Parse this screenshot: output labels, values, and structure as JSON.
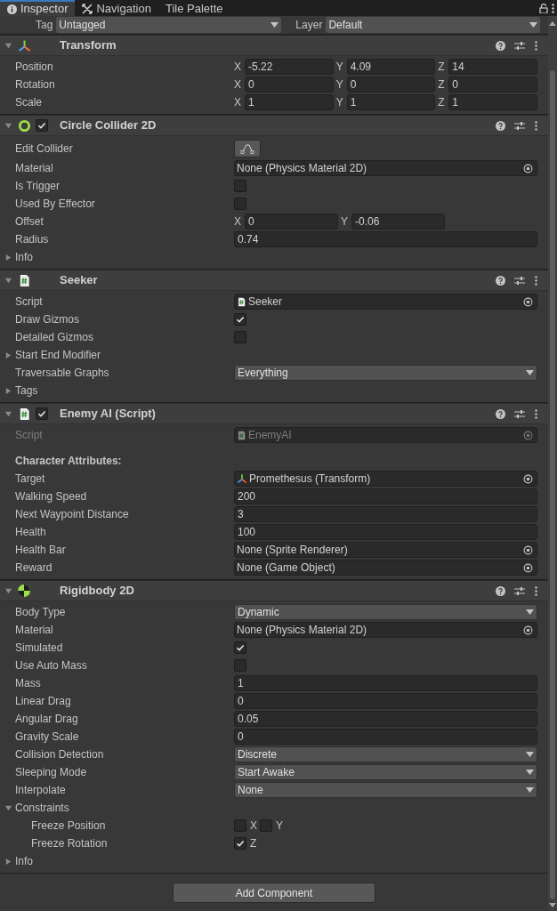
{
  "tabs": [
    {
      "label": "Inspector",
      "kind": "info",
      "selected": true
    },
    {
      "label": "Navigation",
      "kind": "nav",
      "selected": false
    },
    {
      "label": "Tile Palette",
      "kind": "none",
      "selected": false
    }
  ],
  "tag_row": {
    "tag_label": "Tag",
    "tag_value": "Untagged",
    "layer_label": "Layer",
    "layer_value": "Default"
  },
  "components": [
    {
      "title": "Transform",
      "kind": "transform",
      "rows": [
        {
          "kind": "vector",
          "label": "Position",
          "fields": [
            {
              "axis": "X",
              "value": "-5.22"
            },
            {
              "axis": "Y",
              "value": "4.09"
            },
            {
              "axis": "Z",
              "value": "14"
            }
          ]
        },
        {
          "kind": "vector",
          "label": "Rotation",
          "fields": [
            {
              "axis": "X",
              "value": "0"
            },
            {
              "axis": "Y",
              "value": "0"
            },
            {
              "axis": "Z",
              "value": "0"
            }
          ]
        },
        {
          "kind": "vector",
          "label": "Scale",
          "fields": [
            {
              "axis": "X",
              "value": "1"
            },
            {
              "axis": "Y",
              "value": "1"
            },
            {
              "axis": "Z",
              "value": "1"
            }
          ]
        }
      ]
    },
    {
      "title": "Circle Collider 2D",
      "kind": "collider",
      "enabled": true,
      "rows": [
        {
          "kind": "edit",
          "label": "Edit Collider"
        },
        {
          "kind": "object",
          "label": "Material",
          "value": "None (Physics Material 2D)",
          "disabled": false
        },
        {
          "kind": "checkbox",
          "label": "Is Trigger",
          "checked": false
        },
        {
          "kind": "checkbox",
          "label": "Used By Effector",
          "checked": false
        },
        {
          "kind": "vector",
          "label": "Offset",
          "fields": [
            {
              "axis": "X",
              "value": "0"
            },
            {
              "axis": "Y",
              "value": "-0.06"
            }
          ]
        },
        {
          "kind": "text",
          "label": "Radius",
          "value": "0.74"
        },
        {
          "kind": "foldout",
          "label": "Info",
          "expanded": false
        }
      ]
    },
    {
      "title": "Seeker",
      "kind": "script",
      "rows": [
        {
          "kind": "scriptref",
          "label": "Script",
          "value": "Seeker",
          "disabled": false
        },
        {
          "kind": "checkbox",
          "label": "Draw Gizmos",
          "checked": true
        },
        {
          "kind": "checkbox",
          "label": "Detailed Gizmos",
          "checked": false
        },
        {
          "kind": "foldout",
          "label": "Start End Modifier",
          "expanded": false
        },
        {
          "kind": "dropdown",
          "label": "Traversable Graphs",
          "value": "Everything"
        },
        {
          "kind": "foldout",
          "label": "Tags",
          "expanded": false
        }
      ]
    },
    {
      "title": "Enemy AI (Script)",
      "kind": "script",
      "enabled": true,
      "rows": [
        {
          "kind": "scriptref",
          "label": "Script",
          "value": "EnemyAI",
          "disabled": true
        },
        {
          "kind": "header",
          "label": "Character Attributes:"
        },
        {
          "kind": "transformref",
          "label": "Target",
          "value": "Promethesus (Transform)",
          "disabled": false
        },
        {
          "kind": "text",
          "label": "Walking Speed",
          "value": "200"
        },
        {
          "kind": "text",
          "label": "Next Waypoint Distance",
          "value": "3"
        },
        {
          "kind": "text",
          "label": "Health",
          "value": "100"
        },
        {
          "kind": "object",
          "label": "Health Bar",
          "value": "None (Sprite Renderer)",
          "disabled": false
        },
        {
          "kind": "object",
          "label": "Reward",
          "value": "None (Game Object)",
          "disabled": false
        }
      ]
    },
    {
      "title": "Rigidbody 2D",
      "kind": "rigidbody",
      "rows": [
        {
          "kind": "dropdown",
          "label": "Body Type",
          "value": "Dynamic"
        },
        {
          "kind": "object",
          "label": "Material",
          "value": "None (Physics Material 2D)",
          "disabled": false
        },
        {
          "kind": "checkbox",
          "label": "Simulated",
          "checked": true
        },
        {
          "kind": "checkbox",
          "label": "Use Auto Mass",
          "checked": false
        },
        {
          "kind": "text",
          "label": "Mass",
          "value": "1"
        },
        {
          "kind": "text",
          "label": "Linear Drag",
          "value": "0"
        },
        {
          "kind": "text",
          "label": "Angular Drag",
          "value": "0.05"
        },
        {
          "kind": "text",
          "label": "Gravity Scale",
          "value": "0"
        },
        {
          "kind": "dropdown",
          "label": "Collision Detection",
          "value": "Discrete"
        },
        {
          "kind": "dropdown",
          "label": "Sleeping Mode",
          "value": "Start Awake"
        },
        {
          "kind": "dropdown",
          "label": "Interpolate",
          "value": "None"
        },
        {
          "kind": "foldout",
          "label": "Constraints",
          "expanded": true,
          "children": [
            {
              "kind": "checkgroup",
              "label": "Freeze Position",
              "items": [
                {
                  "label": "X",
                  "checked": false
                },
                {
                  "label": "Y",
                  "checked": false
                }
              ]
            },
            {
              "kind": "checkgroup",
              "label": "Freeze Rotation",
              "items": [
                {
                  "label": "Z",
                  "checked": true
                }
              ]
            }
          ]
        },
        {
          "kind": "foldout",
          "label": "Info",
          "expanded": false
        }
      ]
    }
  ],
  "add_button": "Add Component"
}
